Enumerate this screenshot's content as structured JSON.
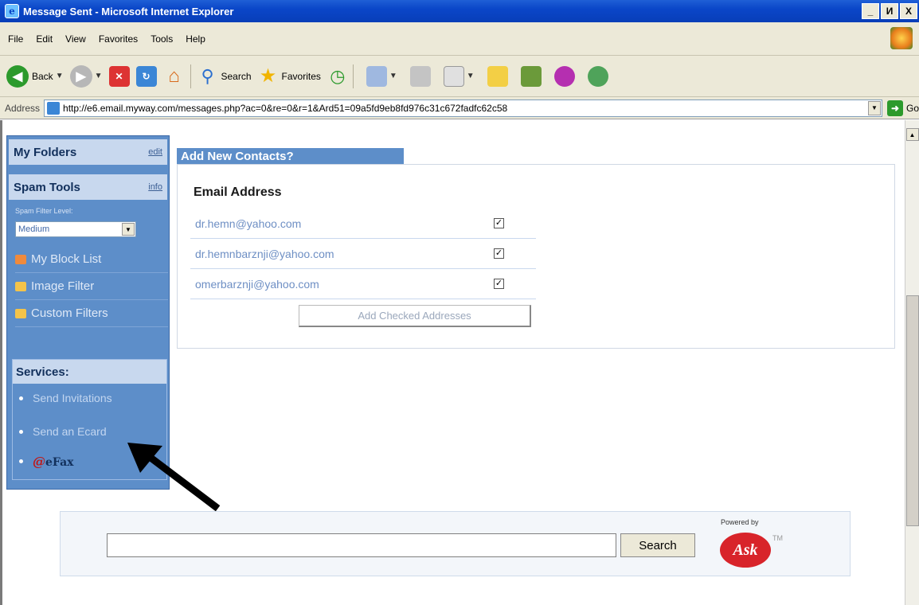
{
  "window": {
    "title": "Message Sent - Microsoft Internet Explorer",
    "buttons": [
      "_",
      "И",
      "X"
    ]
  },
  "menu": [
    "File",
    "Edit",
    "View",
    "Favorites",
    "Tools",
    "Help"
  ],
  "toolbar": {
    "back_label": "Back",
    "search_label": "Search",
    "favorites_label": "Favorites"
  },
  "address": {
    "label": "Address",
    "url": "http://e6.email.myway.com/messages.php?ac=0&re=0&r=1&Ard51=09a5fd9eb8fd976c31c672fadfc62c58",
    "go_label": "Go"
  },
  "sidebar": {
    "my_folders": {
      "title": "My Folders",
      "link": "edit"
    },
    "spam_tools": {
      "title": "Spam Tools",
      "link": "info"
    },
    "spam_filter_label": "Spam Filter Level:",
    "spam_filter_value": "Medium",
    "items": [
      {
        "label": "My Block List",
        "icon": "block-list-icon",
        "color": "#f08a3c"
      },
      {
        "label": "Image Filter",
        "icon": "image-filter-icon",
        "color": "#f3c34a"
      },
      {
        "label": "Custom Filters",
        "icon": "custom-filters-icon",
        "color": "#f3c34a"
      }
    ],
    "services": {
      "title": "Services:",
      "items": [
        "Send Invitations",
        "Send an Ecard"
      ],
      "efax": "eFax"
    }
  },
  "contacts": {
    "tab_title": "Add New Contacts?",
    "heading": "Email Address",
    "rows": [
      {
        "email": "dr.hemn@yahoo.com",
        "checked": true
      },
      {
        "email": "dr.hemnbarznji@yahoo.com",
        "checked": true
      },
      {
        "email": "omerbarznji@yahoo.com",
        "checked": true
      }
    ],
    "button": "Add Checked Addresses"
  },
  "search": {
    "button": "Search",
    "powered_by": "Powered by",
    "brand": "Ask",
    "tm": "TM"
  }
}
